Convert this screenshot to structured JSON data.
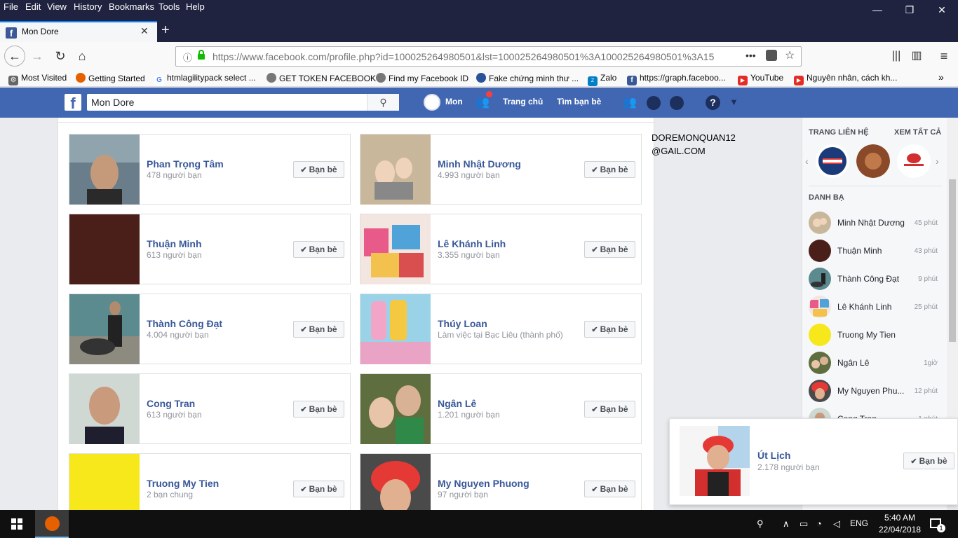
{
  "browser": {
    "menu": [
      "File",
      "Edit",
      "View",
      "History",
      "Bookmarks",
      "Tools",
      "Help"
    ],
    "window_controls": {
      "minimize": "—",
      "restore": "❐",
      "close": "✕"
    },
    "tab": {
      "title": "Mon Dore",
      "close": "✕"
    },
    "new_tab": "+",
    "url": "https://www.facebook.com/profile.php?id=100025264980501&lst=100025264980501%3A100025264980501%3A15",
    "bookmarks": [
      {
        "label": "Most Visited",
        "icon": "gear-icon"
      },
      {
        "label": "Getting Started",
        "icon": "firefox-icon"
      },
      {
        "label": "htmlagilitypack select ...",
        "icon": "google-icon"
      },
      {
        "label": "GET TOKEN FACEBOOK",
        "icon": "globe-icon"
      },
      {
        "label": "Find my Facebook ID",
        "icon": "globe-icon"
      },
      {
        "label": "Fake chứng minh thư ...",
        "icon": "user-icon"
      },
      {
        "label": "Zalo",
        "icon": "zalo-icon"
      },
      {
        "label": "https://graph.faceboo...",
        "icon": "facebook-icon"
      },
      {
        "label": "YouTube",
        "icon": "youtube-icon"
      },
      {
        "label": "Nguyên nhân, cách kh...",
        "icon": "youtube-icon"
      }
    ]
  },
  "facebook": {
    "search_value": "Mon Dore",
    "user_name": "Mon",
    "nav_home": "Trang chủ",
    "nav_find_friends": "Tìm bạn bè",
    "colors": {
      "brand": "#4267b2",
      "link": "#385898"
    }
  },
  "friends": [
    {
      "name": "Phan Trọng Tâm",
      "sub": "478 người bạn",
      "button": "Bạn bè"
    },
    {
      "name": "Minh Nhật Dương",
      "sub": "4.993 người bạn",
      "button": "Bạn bè"
    },
    {
      "name": "Thuận Minh",
      "sub": "613 người bạn",
      "button": "Bạn bè"
    },
    {
      "name": "Lê Khánh Linh",
      "sub": "3.355 người bạn",
      "button": "Bạn bè"
    },
    {
      "name": "Thành Công Đạt",
      "sub": "4.004 người bạn",
      "button": "Bạn bè"
    },
    {
      "name": "Thúy Loan",
      "sub": "Làm việc tại Bạc Liêu (thành phố)",
      "button": "Bạn bè"
    },
    {
      "name": "Cong Tran",
      "sub": "613 người bạn",
      "button": "Bạn bè"
    },
    {
      "name": "Ngân Lê",
      "sub": "1.201 người bạn",
      "button": "Bạn bè"
    },
    {
      "name": "Truong My Tien",
      "sub": "2 bạn chung",
      "button": "Bạn bè"
    },
    {
      "name": "My Nguyen Phuong",
      "sub": "97 người bạn",
      "button": "Bạn bè"
    }
  ],
  "email_text": [
    "DOREMONQUAN12",
    "@GAIL.COM"
  ],
  "sidebar": {
    "pages_title": "TRANG LIÊN HỆ",
    "see_all": "XEM TẤT CẢ",
    "contacts_title": "DANH BẠ",
    "contacts": [
      {
        "name": "Minh Nhật Dương",
        "time": "45 phút"
      },
      {
        "name": "Thuận Minh",
        "time": "43 phút"
      },
      {
        "name": "Thành Công Đạt",
        "time": "9 phút"
      },
      {
        "name": "Lê Khánh Linh",
        "time": "25 phút"
      },
      {
        "name": "Truong My Tien",
        "time": ""
      },
      {
        "name": "Ngân Lê",
        "time": "1giờ"
      },
      {
        "name": "My Nguyen Phu...",
        "time": "12 phút"
      },
      {
        "name": "Cong Tran",
        "time": "1 phút"
      }
    ]
  },
  "popup": {
    "name": "Út Lịch",
    "sub": "2.178 người bạn",
    "button": "Bạn bè"
  },
  "taskbar": {
    "lang": "ENG",
    "time": "5:40 AM",
    "date": "22/04/2018",
    "notif_count": "1"
  }
}
